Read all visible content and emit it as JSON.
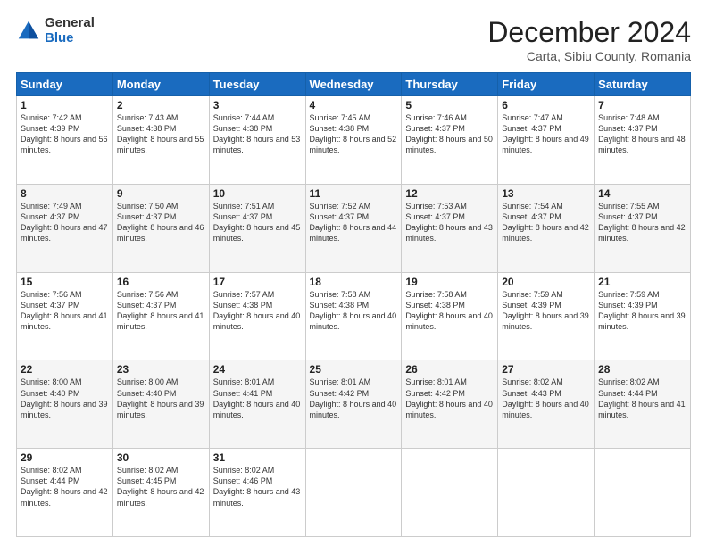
{
  "header": {
    "logo_general": "General",
    "logo_blue": "Blue",
    "month_title": "December 2024",
    "subtitle": "Carta, Sibiu County, Romania"
  },
  "days_of_week": [
    "Sunday",
    "Monday",
    "Tuesday",
    "Wednesday",
    "Thursday",
    "Friday",
    "Saturday"
  ],
  "weeks": [
    [
      {
        "day": "1",
        "sunrise": "7:42 AM",
        "sunset": "4:39 PM",
        "daylight": "8 hours and 56 minutes."
      },
      {
        "day": "2",
        "sunrise": "7:43 AM",
        "sunset": "4:38 PM",
        "daylight": "8 hours and 55 minutes."
      },
      {
        "day": "3",
        "sunrise": "7:44 AM",
        "sunset": "4:38 PM",
        "daylight": "8 hours and 53 minutes."
      },
      {
        "day": "4",
        "sunrise": "7:45 AM",
        "sunset": "4:38 PM",
        "daylight": "8 hours and 52 minutes."
      },
      {
        "day": "5",
        "sunrise": "7:46 AM",
        "sunset": "4:37 PM",
        "daylight": "8 hours and 50 minutes."
      },
      {
        "day": "6",
        "sunrise": "7:47 AM",
        "sunset": "4:37 PM",
        "daylight": "8 hours and 49 minutes."
      },
      {
        "day": "7",
        "sunrise": "7:48 AM",
        "sunset": "4:37 PM",
        "daylight": "8 hours and 48 minutes."
      }
    ],
    [
      {
        "day": "8",
        "sunrise": "7:49 AM",
        "sunset": "4:37 PM",
        "daylight": "8 hours and 47 minutes."
      },
      {
        "day": "9",
        "sunrise": "7:50 AM",
        "sunset": "4:37 PM",
        "daylight": "8 hours and 46 minutes."
      },
      {
        "day": "10",
        "sunrise": "7:51 AM",
        "sunset": "4:37 PM",
        "daylight": "8 hours and 45 minutes."
      },
      {
        "day": "11",
        "sunrise": "7:52 AM",
        "sunset": "4:37 PM",
        "daylight": "8 hours and 44 minutes."
      },
      {
        "day": "12",
        "sunrise": "7:53 AM",
        "sunset": "4:37 PM",
        "daylight": "8 hours and 43 minutes."
      },
      {
        "day": "13",
        "sunrise": "7:54 AM",
        "sunset": "4:37 PM",
        "daylight": "8 hours and 42 minutes."
      },
      {
        "day": "14",
        "sunrise": "7:55 AM",
        "sunset": "4:37 PM",
        "daylight": "8 hours and 42 minutes."
      }
    ],
    [
      {
        "day": "15",
        "sunrise": "7:56 AM",
        "sunset": "4:37 PM",
        "daylight": "8 hours and 41 minutes."
      },
      {
        "day": "16",
        "sunrise": "7:56 AM",
        "sunset": "4:37 PM",
        "daylight": "8 hours and 41 minutes."
      },
      {
        "day": "17",
        "sunrise": "7:57 AM",
        "sunset": "4:38 PM",
        "daylight": "8 hours and 40 minutes."
      },
      {
        "day": "18",
        "sunrise": "7:58 AM",
        "sunset": "4:38 PM",
        "daylight": "8 hours and 40 minutes."
      },
      {
        "day": "19",
        "sunrise": "7:58 AM",
        "sunset": "4:38 PM",
        "daylight": "8 hours and 40 minutes."
      },
      {
        "day": "20",
        "sunrise": "7:59 AM",
        "sunset": "4:39 PM",
        "daylight": "8 hours and 39 minutes."
      },
      {
        "day": "21",
        "sunrise": "7:59 AM",
        "sunset": "4:39 PM",
        "daylight": "8 hours and 39 minutes."
      }
    ],
    [
      {
        "day": "22",
        "sunrise": "8:00 AM",
        "sunset": "4:40 PM",
        "daylight": "8 hours and 39 minutes."
      },
      {
        "day": "23",
        "sunrise": "8:00 AM",
        "sunset": "4:40 PM",
        "daylight": "8 hours and 39 minutes."
      },
      {
        "day": "24",
        "sunrise": "8:01 AM",
        "sunset": "4:41 PM",
        "daylight": "8 hours and 40 minutes."
      },
      {
        "day": "25",
        "sunrise": "8:01 AM",
        "sunset": "4:42 PM",
        "daylight": "8 hours and 40 minutes."
      },
      {
        "day": "26",
        "sunrise": "8:01 AM",
        "sunset": "4:42 PM",
        "daylight": "8 hours and 40 minutes."
      },
      {
        "day": "27",
        "sunrise": "8:02 AM",
        "sunset": "4:43 PM",
        "daylight": "8 hours and 40 minutes."
      },
      {
        "day": "28",
        "sunrise": "8:02 AM",
        "sunset": "4:44 PM",
        "daylight": "8 hours and 41 minutes."
      }
    ],
    [
      {
        "day": "29",
        "sunrise": "8:02 AM",
        "sunset": "4:44 PM",
        "daylight": "8 hours and 42 minutes."
      },
      {
        "day": "30",
        "sunrise": "8:02 AM",
        "sunset": "4:45 PM",
        "daylight": "8 hours and 42 minutes."
      },
      {
        "day": "31",
        "sunrise": "8:02 AM",
        "sunset": "4:46 PM",
        "daylight": "8 hours and 43 minutes."
      },
      null,
      null,
      null,
      null
    ]
  ]
}
